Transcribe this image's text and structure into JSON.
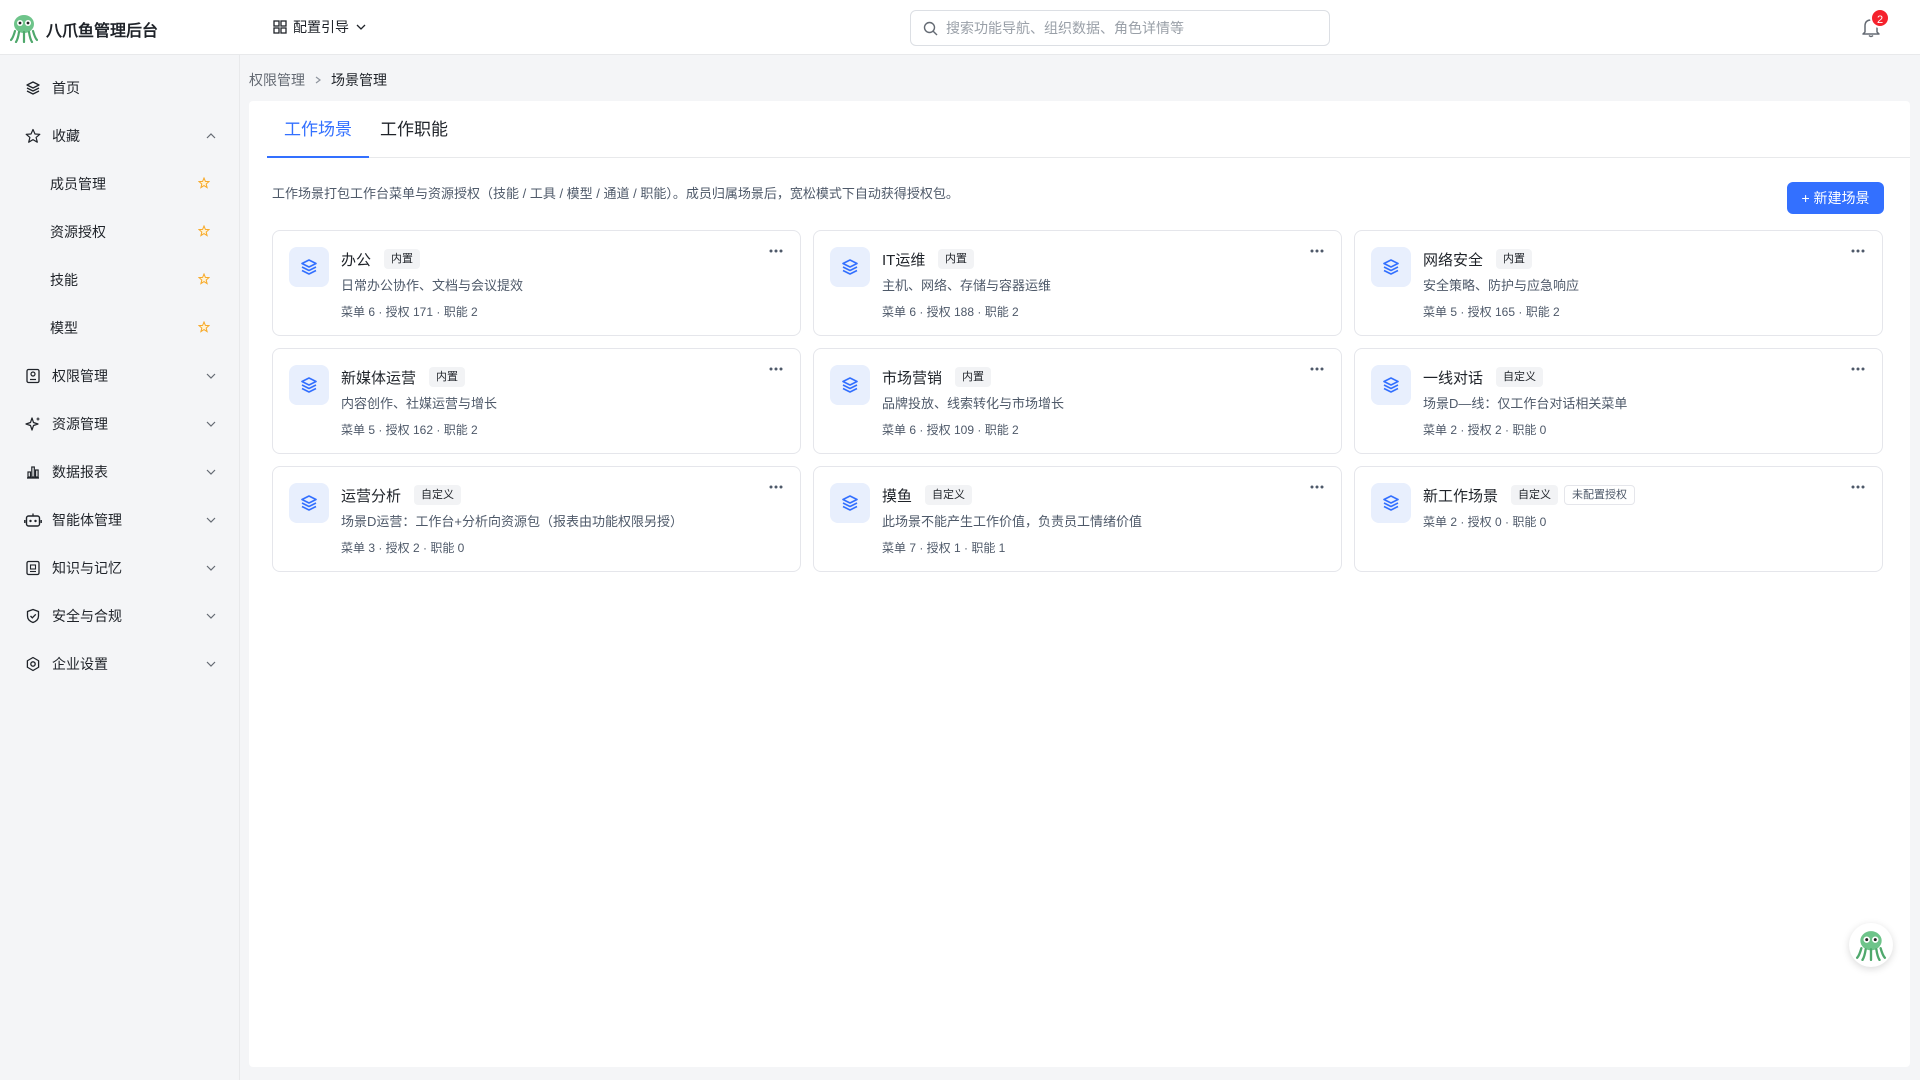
{
  "app": {
    "title": "八爪鱼管理后台",
    "logo_icon": "octopus-logo"
  },
  "header": {
    "guide_label": "配置引导",
    "search_placeholder": "搜索功能导航、组织数据、角色详情等",
    "notification_count": "2"
  },
  "sidebar": {
    "home": "首页",
    "favorites": {
      "label": "收藏",
      "expanded": true,
      "items": [
        "成员管理",
        "资源授权",
        "技能",
        "模型"
      ]
    },
    "groups": [
      "权限管理",
      "资源管理",
      "数据报表",
      "智能体管理",
      "知识与记忆",
      "安全与合规",
      "企业设置"
    ]
  },
  "breadcrumb": {
    "parent": "权限管理",
    "current": "场景管理"
  },
  "tabs": [
    {
      "label": "工作场景",
      "active": true
    },
    {
      "label": "工作职能",
      "active": false
    }
  ],
  "description": "工作场景打包工作台菜单与资源授权（技能 / 工具 / 模型 / 通道 / 职能）。成员归属场景后，宽松模式下自动获得授权包。",
  "new_button": "+ 新建场景",
  "cards": [
    {
      "name": "办公",
      "tags": [
        "内置"
      ],
      "desc": "日常办公协作、文档与会议提效",
      "stats": "菜单 6 · 授权 171 · 职能 2"
    },
    {
      "name": "IT运维",
      "tags": [
        "内置"
      ],
      "desc": "主机、网络、存储与容器运维",
      "stats": "菜单 6 · 授权 188 · 职能 2"
    },
    {
      "name": "网络安全",
      "tags": [
        "内置"
      ],
      "desc": "安全策略、防护与应急响应",
      "stats": "菜单 5 · 授权 165 · 职能 2"
    },
    {
      "name": "新媒体运营",
      "tags": [
        "内置"
      ],
      "desc": "内容创作、社媒运营与增长",
      "stats": "菜单 5 · 授权 162 · 职能 2"
    },
    {
      "name": "市场营销",
      "tags": [
        "内置"
      ],
      "desc": "品牌投放、线索转化与市场增长",
      "stats": "菜单 6 · 授权 109 · 职能 2"
    },
    {
      "name": "一线对话",
      "tags": [
        "自定义"
      ],
      "desc": "场景D—线：仅工作台对话相关菜单",
      "stats": "菜单 2 · 授权 2 · 职能 0"
    },
    {
      "name": "运营分析",
      "tags": [
        "自定义"
      ],
      "desc": "场景D运营：工作台+分析向资源包（报表由功能权限另授）",
      "stats": "菜单 3 · 授权 2 · 职能 0"
    },
    {
      "name": "摸鱼",
      "tags": [
        "自定义"
      ],
      "desc": "此场景不能产生工作价值，负责员工情绪价值",
      "stats": "菜单 7 · 授权 1 · 职能 1"
    },
    {
      "name": "新工作场景",
      "tags": [
        "自定义",
        "未配置授权"
      ],
      "desc": "",
      "stats": "菜单 2 · 授权 0 · 职能 0"
    }
  ],
  "colors": {
    "primary": "#3370ff",
    "badge": "#f5222d",
    "star": "#f7a928"
  }
}
